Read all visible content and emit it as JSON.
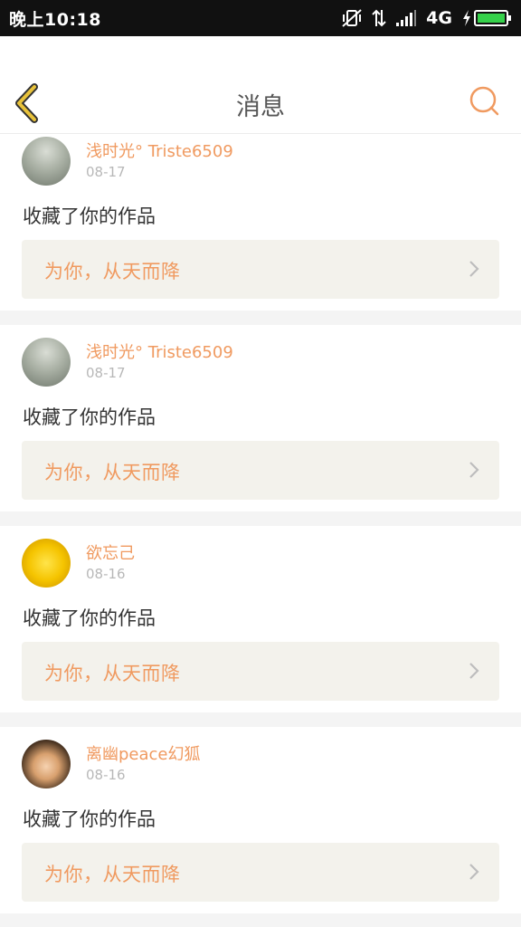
{
  "status_bar": {
    "time": "晚上10:18",
    "network": "4G",
    "icons": [
      "vibrate-off-icon",
      "data-transfer-icon",
      "signal-icon",
      "battery-charging-icon"
    ]
  },
  "header": {
    "title": "消息",
    "back_icon": "chevron-left-icon",
    "search_icon": "search-icon"
  },
  "colors": {
    "accent": "#f09a60",
    "back_arrow": "#e8c23a",
    "card_bg": "#f3f2ec",
    "separator": "#f4f4f4"
  },
  "notifications": [
    {
      "username": "浅时光° Triste6509",
      "date": "08-17",
      "action": "收藏了你的作品",
      "work_title": "为你，从天而降"
    },
    {
      "username": "浅时光° Triste6509",
      "date": "08-17",
      "action": "收藏了你的作品",
      "work_title": "为你，从天而降"
    },
    {
      "username": "欲忘己",
      "date": "08-16",
      "action": "收藏了你的作品",
      "work_title": "为你，从天而降"
    },
    {
      "username": "离幽peace幻狐",
      "date": "08-16",
      "action": "收藏了你的作品",
      "work_title": "为你，从天而降"
    }
  ]
}
